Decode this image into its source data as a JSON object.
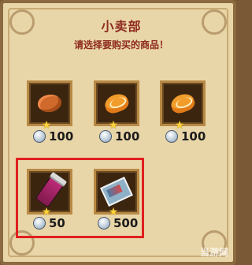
{
  "shop": {
    "title": "小卖部",
    "subtitle": "请选择要购买的商品！",
    "items": [
      {
        "name": "nut",
        "price": "100",
        "stars": 1
      },
      {
        "name": "orange-slice",
        "price": "100",
        "stars": 1
      },
      {
        "name": "orange-slice",
        "price": "100",
        "stars": 1
      },
      {
        "name": "lighter",
        "price": "50",
        "stars": 1
      },
      {
        "name": "card",
        "price": "500",
        "stars": 1
      }
    ]
  },
  "watermark": "当游网"
}
